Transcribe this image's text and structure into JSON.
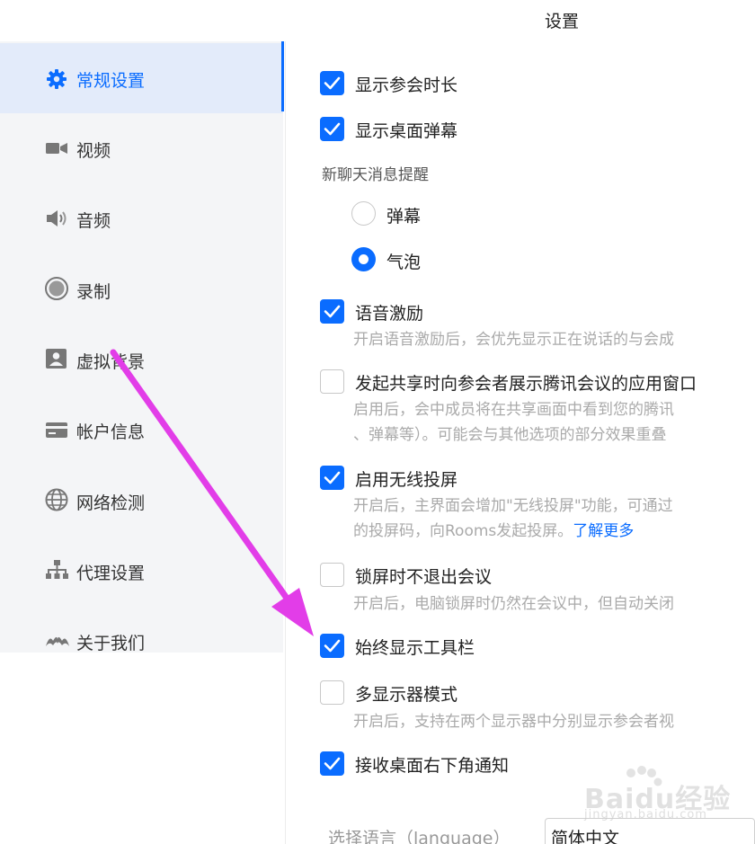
{
  "window": {
    "title": "设置"
  },
  "sidebar": {
    "items": [
      {
        "label": "常规设置",
        "icon": "gear-icon",
        "active": true
      },
      {
        "label": "视频",
        "icon": "video-icon"
      },
      {
        "label": "音频",
        "icon": "speaker-icon"
      },
      {
        "label": "录制",
        "icon": "record-icon"
      },
      {
        "label": "虚拟背景",
        "icon": "portrait-icon"
      },
      {
        "label": "帐户信息",
        "icon": "card-icon"
      },
      {
        "label": "网络检测",
        "icon": "globe-icon"
      },
      {
        "label": "代理设置",
        "icon": "network-icon"
      },
      {
        "label": "关于我们",
        "icon": "logo-icon"
      }
    ]
  },
  "settings": {
    "show_duration": {
      "label": "显示参会时长",
      "checked": true
    },
    "show_danmu": {
      "label": "显示桌面弹幕",
      "checked": true
    },
    "chat_alert": {
      "label": "新聊天消息提醒",
      "options": [
        {
          "label": "弹幕",
          "selected": false
        },
        {
          "label": "气泡",
          "selected": true
        }
      ]
    },
    "voice_motivation": {
      "label": "语音激励",
      "checked": true,
      "desc": "开启语音激励后，会优先显示正在说话的与会成"
    },
    "share_app_window": {
      "label": "发起共享时向参会者展示腾讯会议的应用窗口",
      "checked": false,
      "desc_line1": "启用后，会中成员将在共享画面中看到您的腾讯",
      "desc_line2": "、弹幕等）。可能会与其他选项的部分效果重叠"
    },
    "wireless_cast": {
      "label": "启用无线投屏",
      "checked": true,
      "desc_line1": "开启后，主界面会增加\"无线投屏\"功能，可通过",
      "desc_line2": "的投屏码，向Rooms发起投屏。",
      "link": "了解更多"
    },
    "lock_screen": {
      "label": "锁屏时不退出会议",
      "checked": false,
      "desc": "开启后，电脑锁屏时仍然在会议中，但自动关闭"
    },
    "always_toolbar": {
      "label": "始终显示工具栏",
      "checked": true
    },
    "multi_display": {
      "label": "多显示器模式",
      "checked": false,
      "desc": "开启后，支持在两个显示器中分别显示参会者视"
    },
    "desktop_notify": {
      "label": "接收桌面右下角通知",
      "checked": true
    },
    "language": {
      "label": "选择语言（language）",
      "value": "简体中文"
    }
  },
  "annotation": {
    "color": "#e23de8"
  },
  "watermark": {
    "text": "Baidu经验",
    "sub": "jingyan.baidu.com"
  },
  "colors": {
    "accent": "#0a6cff",
    "sidebar_bg": "#f4f5f7",
    "active_bg": "#e3ebfa"
  }
}
